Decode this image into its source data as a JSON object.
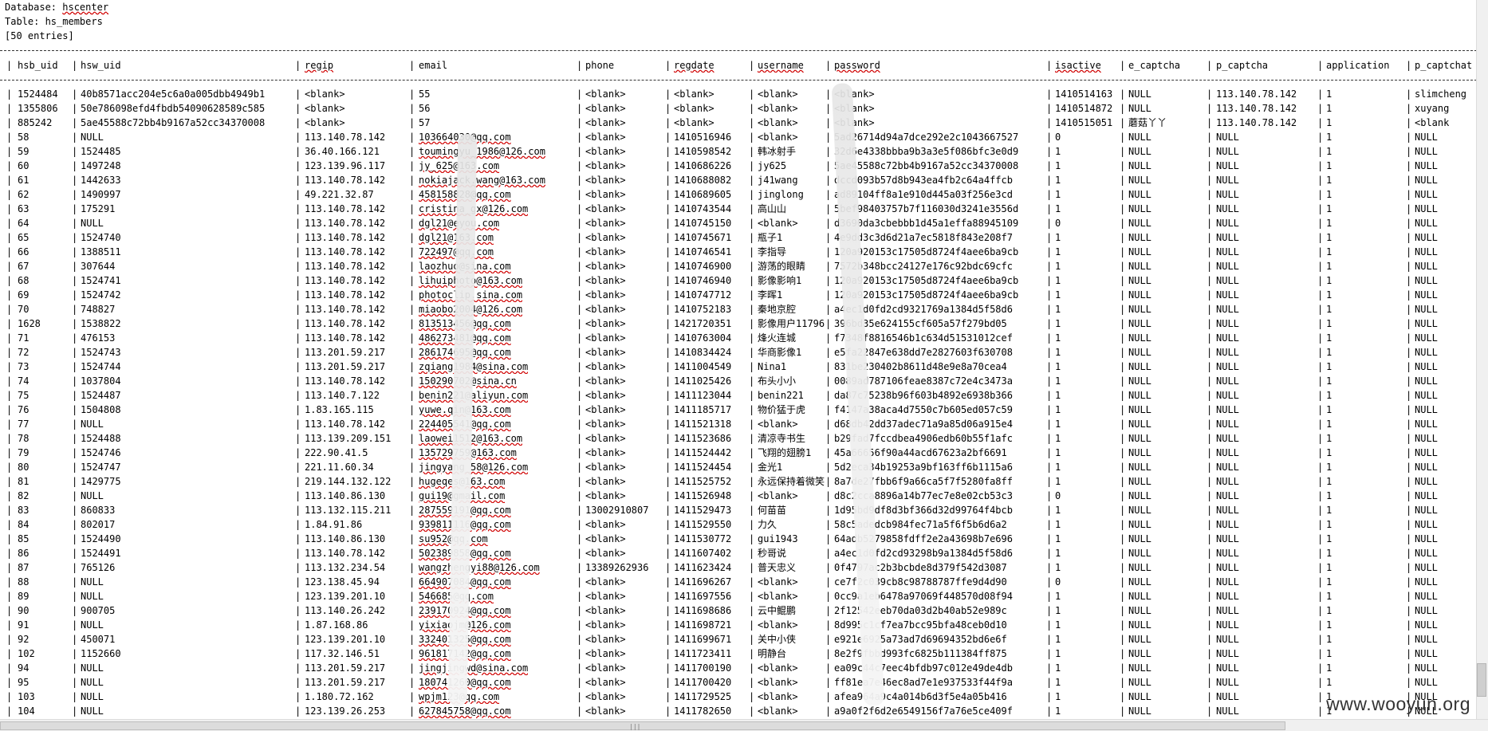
{
  "header": {
    "database_label": "Database: ",
    "database_name": "hscenter",
    "table_label": "Table: ",
    "table_name": "hs_members",
    "entries": "[50 entries]"
  },
  "columns": [
    "hsb_uid",
    "hsw_uid",
    "regip",
    "email",
    "phone",
    "regdate",
    "username",
    "password",
    "isactive",
    "e_captcha",
    "p_captcha",
    "application",
    "p_captchat"
  ],
  "underlined_columns": [
    "regip",
    "regdate",
    "username",
    "password",
    "isactive"
  ],
  "rows": [
    [
      "1524484",
      "40b8571acc204e5c6a0a005dbb4949b1",
      "<blank>",
      "55",
      "<blank>",
      "<blank>",
      "<blank>",
      "<blank>",
      "1410514163",
      "NULL",
      "113.140.78.142",
      "1",
      "slimcheng"
    ],
    [
      "1355806",
      "50e786098efd4fbdb54090628589c585",
      "<blank>",
      "56",
      "<blank>",
      "<blank>",
      "<blank>",
      "<blank>",
      "1410514872",
      "NULL",
      "113.140.78.142",
      "1",
      "xuyang"
    ],
    [
      "885242",
      "5ae45588c72bb4b9167a52cc34370008",
      "<blank>",
      "57",
      "<blank>",
      "<blank>",
      "<blank>",
      "<blank>",
      "1410515051",
      "蘑菇丫丫",
      "113.140.78.142",
      "1",
      "<blank"
    ],
    [
      "58",
      "NULL",
      "113.140.78.142",
      "103664030@qq.com",
      "<blank>",
      "1410516946",
      "<blank>",
      "5ad26714d94a7dce292e2c1043667527",
      "0",
      "NULL",
      "NULL",
      "1",
      "NULL"
    ],
    [
      "59",
      "1524485",
      "36.40.166.121",
      "toumingyu_1986@126.com",
      "<blank>",
      "1410598542",
      "韩冰射手",
      "32d6e4338bbba9b3a3e5f086bfc3e0d9",
      "1",
      "NULL",
      "NULL",
      "1",
      "NULL"
    ],
    [
      "60",
      "1497248",
      "123.139.96.117",
      "jy_625@163.com",
      "<blank>",
      "1410686226",
      "jy625",
      "5ae45588c72bb4b9167a52cc34370008",
      "1",
      "NULL",
      "NULL",
      "1",
      "NULL"
    ],
    [
      "61",
      "1442633",
      "113.140.78.142",
      "nokiajack.wang@163.com",
      "<blank>",
      "1410688082",
      "j41wang",
      "dccd093b57d8b943ea4fb2c64a4ffcb",
      "1",
      "NULL",
      "NULL",
      "1",
      "NULL"
    ],
    [
      "62",
      "1490997",
      "49.221.32.87",
      "458158828@qq.com",
      "<blank>",
      "1410689605",
      "jinglong",
      "ad89104ff8a1e910d445a03f256e3cd",
      "1",
      "NULL",
      "NULL",
      "1",
      "NULL"
    ],
    [
      "63",
      "175291",
      "113.140.78.142",
      "cristina_gx@126.com",
      "<blank>",
      "1410743544",
      "高山山",
      "5bef98403757b7f116030d3241e3556d",
      "1",
      "NULL",
      "NULL",
      "1",
      "NULL"
    ],
    [
      "64",
      "NULL",
      "113.140.78.142",
      "dgl21@eyou.com",
      "<blank>",
      "1410745150",
      "<blank>",
      "d3690da3cbebbb1d45a1effa88945109",
      "0",
      "NULL",
      "NULL",
      "1",
      "NULL"
    ],
    [
      "65",
      "1524740",
      "113.140.78.142",
      "dgl21@163.com",
      "<blank>",
      "1410745671",
      "瓶子1",
      "4e9dd3c3d6d21a7ec5818f843e208f7",
      "1",
      "NULL",
      "NULL",
      "1",
      "NULL"
    ],
    [
      "66",
      "1388511",
      "113.140.78.142",
      "722497@qq.com",
      "<blank>",
      "1410746541",
      "李指导",
      "120a920153c17505d8724f4aee6ba9cb",
      "1",
      "NULL",
      "NULL",
      "1",
      "NULL"
    ],
    [
      "67",
      "307644",
      "113.140.78.142",
      "laozhuo@sina.com",
      "<blank>",
      "1410746900",
      "游荡的眼睛",
      "7572b348bcc24127e176c92bdc69cfc",
      "1",
      "NULL",
      "NULL",
      "1",
      "NULL"
    ],
    [
      "68",
      "1524741",
      "113.140.78.142",
      "lihuiphoto@163.com",
      "<blank>",
      "1410746940",
      "影像影响1",
      "120a920153c17505d8724f4aee6ba9cb",
      "1",
      "NULL",
      "NULL",
      "1",
      "NULL"
    ],
    [
      "69",
      "1524742",
      "113.140.78.142",
      "photoclip.sina.com",
      "<blank>",
      "1410747712",
      "李晖1",
      "120a920153c17505d8724f4aee6ba9cb",
      "1",
      "NULL",
      "NULL",
      "1",
      "NULL"
    ],
    [
      "70",
      "748827",
      "113.140.78.142",
      "miaobo2004@126.com",
      "<blank>",
      "1410752183",
      "秦地京腔",
      "a4ec1d0fd2cd9321769a1384d5f58d6",
      "1",
      "NULL",
      "NULL",
      "1",
      "NULL"
    ],
    [
      "1628",
      "1538822",
      "113.140.78.142",
      "813513456@qq.com",
      "<blank>",
      "1421720351",
      "影像用户11796",
      "396bd35e624155cf605a57f279bd05",
      "1",
      "NULL",
      "NULL",
      "1",
      "NULL"
    ],
    [
      "71",
      "476153",
      "113.140.78.142",
      "486273481@qq.com",
      "<blank>",
      "1410763004",
      "烽火连城",
      "f7348f8816546b1c634d51531012cef",
      "1",
      "NULL",
      "NULL",
      "1",
      "NULL"
    ],
    [
      "72",
      "1524743",
      "113.201.59.217",
      "286174695@qq.com",
      "<blank>",
      "1410834424",
      "华商影像1",
      "e5fa22847e638dd7e2827603f630708",
      "1",
      "NULL",
      "NULL",
      "1",
      "NULL"
    ],
    [
      "73",
      "1524744",
      "113.201.59.217",
      "zqiang1984@sina.com",
      "<blank>",
      "1411004549",
      "Nina1",
      "831be230402b8611d48e9e8a70cea4",
      "1",
      "NULL",
      "NULL",
      "1",
      "NULL"
    ],
    [
      "74",
      "1037804",
      "113.140.78.142",
      "150290702@sina.cn",
      "<blank>",
      "1411025426",
      "布头小小",
      "0089ad787106feae8387c72e4c3473a",
      "1",
      "NULL",
      "NULL",
      "1",
      "NULL"
    ],
    [
      "75",
      "1524487",
      "113.140.7.122",
      "benin221@aliyun.com",
      "<blank>",
      "1411123044",
      "benin221",
      "da87c75238b96f603b4892e6938b366",
      "1",
      "NULL",
      "NULL",
      "1",
      "NULL"
    ],
    [
      "76",
      "1504808",
      "1.83.165.115",
      "yuwe.qin@163.com",
      "<blank>",
      "1411185717",
      "物价猛于虎",
      "f4147a38aca4d7550c7b605ed057c59",
      "1",
      "NULL",
      "NULL",
      "1",
      "NULL"
    ],
    [
      "77",
      "NULL",
      "113.140.78.142",
      "224405541@qq.com",
      "<blank>",
      "1411521318",
      "<blank>",
      "d68db42dd37adec71a9a85d06a915e4",
      "1",
      "NULL",
      "NULL",
      "1",
      "NULL"
    ],
    [
      "78",
      "1524488",
      "113.139.209.151",
      "laowei1512@163.com",
      "<blank>",
      "1411523686",
      "清凉寺书生",
      "b29fad7fccdbea4906edb60b55f1afc",
      "1",
      "NULL",
      "NULL",
      "1",
      "NULL"
    ],
    [
      "79",
      "1524746",
      "222.90.41.5",
      "135729759@163.com",
      "<blank>",
      "1411524442",
      "飞翔的翅膀1",
      "45a66656f90a44acd67623a2bf6691",
      "1",
      "NULL",
      "NULL",
      "1",
      "NULL"
    ],
    [
      "80",
      "1524747",
      "221.11.60.34",
      "jingyang_58@126.com",
      "<blank>",
      "1411524454",
      "金光1",
      "5d2eca34b19253a9bf163ff6b1115a6",
      "1",
      "NULL",
      "NULL",
      "1",
      "NULL"
    ],
    [
      "81",
      "1429775",
      "219.144.132.122",
      "hugeqes@163.com",
      "<blank>",
      "1411525752",
      "永远保持着微笑",
      "8a7de27fbb6f9a66ca5f7f5280fa8ff",
      "1",
      "NULL",
      "NULL",
      "1",
      "NULL"
    ],
    [
      "82",
      "NULL",
      "113.140.86.130",
      "gui19@gmail.com",
      "<blank>",
      "1411526948",
      "<blank>",
      "d8c2cca8896a14b77ec7e8e02cb53c3",
      "0",
      "NULL",
      "NULL",
      "1",
      "NULL"
    ],
    [
      "83",
      "860833",
      "113.132.115.211",
      "287559191@qq.com",
      "13002910807",
      "1411529473",
      "何苗苗",
      "1d95bd9df8d3bf366d32d99764f4bcb",
      "1",
      "NULL",
      "NULL",
      "1",
      "NULL"
    ],
    [
      "84",
      "802017",
      "1.84.91.86",
      "939811116@qq.com",
      "<blank>",
      "1411529550",
      "力久",
      "58c5adedcb984fec71a5f6f5b6d6a2",
      "1",
      "NULL",
      "NULL",
      "1",
      "NULL"
    ],
    [
      "85",
      "1524490",
      "113.140.86.130",
      "su952@qq.com",
      "<blank>",
      "1411530772",
      "gui1943",
      "64adb5279858fdff2e2a43698b7e696",
      "1",
      "NULL",
      "NULL",
      "1",
      "NULL"
    ],
    [
      "86",
      "1524491",
      "113.140.78.142",
      "502389858@qq.com",
      "<blank>",
      "1411607402",
      "秒哥说",
      "a4ec1d0fd2cd93298b9a1384d5f58d6",
      "1",
      "NULL",
      "NULL",
      "1",
      "NULL"
    ],
    [
      "87",
      "765126",
      "113.132.234.54",
      "wangzhengyi88@126.com",
      "13389262936",
      "1411623424",
      "普天忠义",
      "0f4797ac2b3bcbde8d379f542d3087",
      "1",
      "NULL",
      "NULL",
      "1",
      "NULL"
    ],
    [
      "88",
      "NULL",
      "123.138.45.94",
      "664907084@qq.com",
      "<blank>",
      "1411696267",
      "<blank>",
      "ce7f2c039cb8c98788787ffe9d4d90",
      "0",
      "NULL",
      "NULL",
      "1",
      "NULL"
    ],
    [
      "89",
      "NULL",
      "123.139.201.10",
      "546685@qq.com",
      "<blank>",
      "1411697556",
      "<blank>",
      "0cc9a1eb6478a97069f448570d08f94",
      "1",
      "NULL",
      "NULL",
      "1",
      "NULL"
    ],
    [
      "90",
      "900705",
      "113.140.26.242",
      "239170924@qq.com",
      "<blank>",
      "1411698686",
      "云中鲲鹏",
      "2f12542eeb70da03d2b40ab52e989c",
      "1",
      "NULL",
      "NULL",
      "1",
      "NULL"
    ],
    [
      "91",
      "NULL",
      "1.87.168.86",
      "yixiaojm@126.com",
      "<blank>",
      "1411698721",
      "<blank>",
      "8d995c1cf7ea7bcc95bfa48ceb0d10",
      "1",
      "NULL",
      "NULL",
      "1",
      "NULL"
    ],
    [
      "92",
      "450071",
      "123.139.201.10",
      "332401325@qq.com",
      "<blank>",
      "1411699671",
      "关中小侠",
      "e921e6925a73ad7d69694352bd6e6f",
      "1",
      "NULL",
      "NULL",
      "1",
      "NULL"
    ],
    [
      "102",
      "1152660",
      "117.32.146.51",
      "961817142@qq.com",
      "<blank>",
      "1411723411",
      "明静台",
      "8e2f9fbbd993fc6825b111384ff875",
      "1",
      "NULL",
      "NULL",
      "1",
      "NULL"
    ],
    [
      "94",
      "NULL",
      "113.201.59.217",
      "jingjingwd@sina.com",
      "<blank>",
      "1411700190",
      "<blank>",
      "ea09c44c7eec4bfdb97c012e49de4db",
      "1",
      "NULL",
      "NULL",
      "1",
      "NULL"
    ],
    [
      "95",
      "NULL",
      "113.201.59.217",
      "180741260@qq.com",
      "<blank>",
      "1411700420",
      "<blank>",
      "ff81ea7e46ec8ad7e1e937533f44f9a",
      "1",
      "NULL",
      "NULL",
      "1",
      "NULL"
    ],
    [
      "103",
      "NULL",
      "1.180.72.162",
      "wpjm123@qq.com",
      "<blank>",
      "1411729525",
      "<blank>",
      "afea964a9c4a014b6d3f5e4a05b416",
      "1",
      "NULL",
      "NULL",
      "1",
      "NULL"
    ],
    [
      "104",
      "NULL",
      "123.139.26.253",
      "627845758@qq.com",
      "<blank>",
      "1411782650",
      "<blank>",
      "a9a0f2f6d2e6549156f7a76e5ce409f",
      "1",
      "NULL",
      "NULL",
      "1",
      "NULL"
    ]
  ],
  "watermark": "www.wooyun.org"
}
